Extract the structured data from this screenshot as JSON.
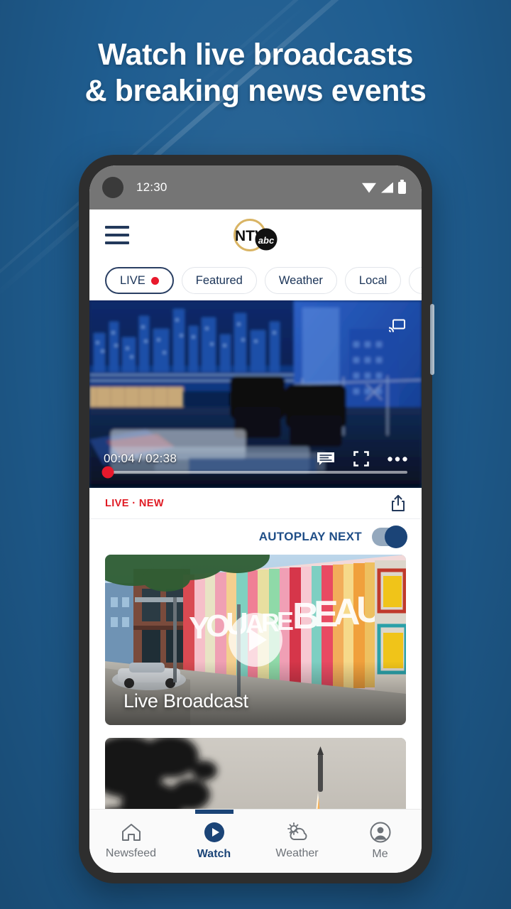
{
  "promo": {
    "headline_line1": "Watch live broadcasts",
    "headline_line2": "& breaking news events"
  },
  "status_bar": {
    "time": "12:30",
    "icons": [
      "wifi-icon",
      "cellular-signal-icon",
      "battery-icon"
    ]
  },
  "app_header": {
    "menu_icon": "hamburger-menu-icon",
    "logo_primary": "NTV",
    "logo_secondary": "abc"
  },
  "tabs": [
    {
      "label": "LIVE",
      "active": true,
      "has_live_dot": true
    },
    {
      "label": "Featured",
      "active": false,
      "has_live_dot": false
    },
    {
      "label": "Weather",
      "active": false,
      "has_live_dot": false
    },
    {
      "label": "Local",
      "active": false,
      "has_live_dot": false
    }
  ],
  "player": {
    "current_time": "00:04",
    "separator": "/",
    "duration": "02:38",
    "timecode": "00:04 / 02:38",
    "progress_percent": 1.5,
    "cast_icon": "cast-icon",
    "captions_icon": "closed-captions-icon",
    "fullscreen_icon": "fullscreen-icon",
    "more_icon": "more-options-icon"
  },
  "meta": {
    "badge_live": "LIVE",
    "badge_separator": "·",
    "badge_new": "NEW",
    "badges_text": "LIVE · NEW",
    "share_icon": "share-icon"
  },
  "autoplay": {
    "label": "AUTOPLAY NEXT",
    "enabled": true
  },
  "feed": [
    {
      "title": "Live Broadcast",
      "has_play_button": true
    },
    {
      "title": "",
      "has_play_button": true
    }
  ],
  "bottom_nav": [
    {
      "label": "Newsfeed",
      "icon": "home-icon",
      "active": false
    },
    {
      "label": "Watch",
      "icon": "play-circle-icon",
      "active": true
    },
    {
      "label": "Weather",
      "icon": "sun-cloud-icon",
      "active": false
    },
    {
      "label": "Me",
      "icon": "account-circle-icon",
      "active": false
    }
  ],
  "colors": {
    "background_blue": "#2a72a8",
    "brand_navy": "#1b4477",
    "live_red": "#e01b24",
    "logo_gold": "#d9b464",
    "status_bar_gray": "#757575"
  }
}
